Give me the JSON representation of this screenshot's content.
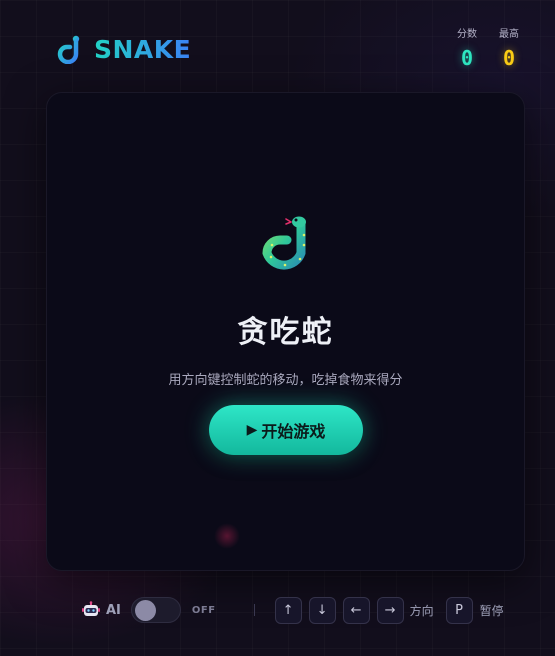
{
  "header": {
    "logo_text": "SNAKE",
    "score_label": "分数",
    "score_value": "0",
    "best_label": "最高",
    "best_value": "0"
  },
  "board": {
    "title": "贪吃蛇",
    "subtitle": "用方向键控制蛇的移动，吃掉食物来得分",
    "start_button_label": "开始游戏"
  },
  "controls": {
    "ai_label": "AI",
    "ai_toggle_state": "OFF",
    "key_up": "↑",
    "key_down": "↓",
    "key_left": "←",
    "key_right": "→",
    "direction_caption": "方向",
    "pause_key": "P",
    "pause_caption": "暂停"
  },
  "colors": {
    "accent_teal": "#2ee6c0",
    "accent_blue": "#3b82f6",
    "best_yellow": "#facc15",
    "board_bg": "#0b0a18"
  },
  "icons": {
    "logo": "snake-icon",
    "overlay": "snake-icon",
    "ai": "robot-icon",
    "start": "play-icon"
  }
}
